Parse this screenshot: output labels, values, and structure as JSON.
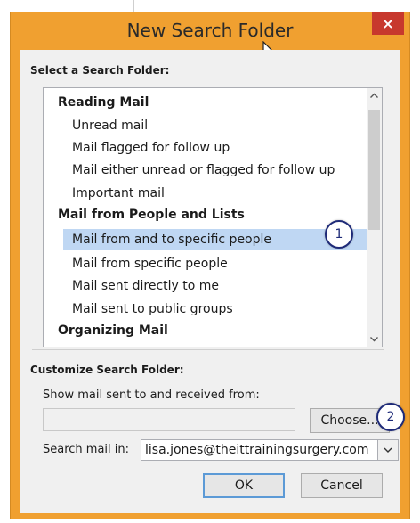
{
  "window": {
    "title": "New Search Folder",
    "close_glyph": "×"
  },
  "select_section": {
    "label": "Select a Search Folder:",
    "groups": [
      {
        "header": "Reading Mail",
        "items": [
          "Unread mail",
          "Mail flagged for follow up",
          "Mail either unread or flagged for follow up",
          "Important mail"
        ]
      },
      {
        "header": "Mail from People and Lists",
        "items": [
          "Mail from and to specific people",
          "Mail from specific people",
          "Mail sent directly to me",
          "Mail sent to public groups"
        ]
      },
      {
        "header": "Organizing Mail",
        "items": []
      }
    ],
    "selected_item": "Mail from and to specific people",
    "scroll_up_glyph": "^",
    "scroll_down_glyph": "v"
  },
  "customize_section": {
    "label": "Customize Search Folder:",
    "show_mail_label": "Show mail sent to and received from:",
    "people_value": "",
    "choose_button": "Choose...",
    "search_in_label": "Search mail in:",
    "search_in_value": "lisa.jones@theittrainingsurgery.com",
    "dropdown_glyph": "v"
  },
  "buttons": {
    "ok": "OK",
    "cancel": "Cancel"
  },
  "callouts": {
    "one": "1",
    "two": "2"
  },
  "colors": {
    "window_frame": "#f0a030",
    "close_button": "#c7382d",
    "selection": "#bfd7f3",
    "callout_border": "#1e2a78"
  },
  "icons": {
    "close": "close-icon",
    "cursor": "mouse-pointer-icon",
    "scroll_up": "chevron-up-icon",
    "scroll_down": "chevron-down-icon",
    "dropdown": "chevron-down-icon"
  }
}
